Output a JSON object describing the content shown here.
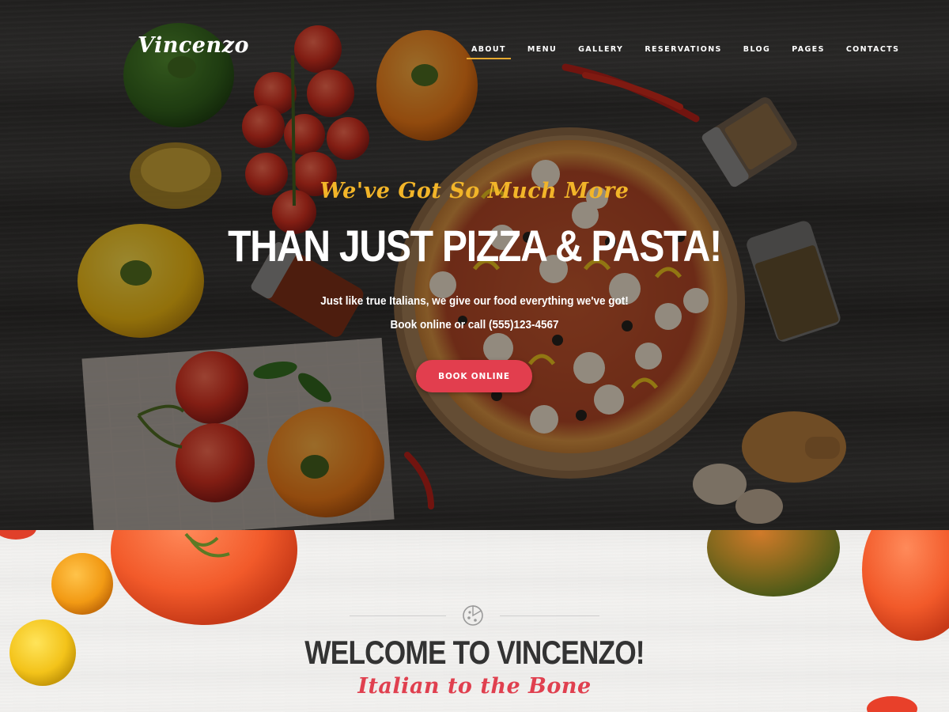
{
  "brand": {
    "logo_text": "Vincenzo"
  },
  "nav": {
    "items": [
      {
        "label": "ABOUT"
      },
      {
        "label": "MENU"
      },
      {
        "label": "GALLERY"
      },
      {
        "label": "RESERVATIONS"
      },
      {
        "label": "BLOG"
      },
      {
        "label": "PAGES"
      },
      {
        "label": "CONTACTS"
      }
    ],
    "active_item": "ABOUT"
  },
  "hero": {
    "script_heading": "We've Got So Much More",
    "title": "THAN JUST PIZZA & PASTA!",
    "subtitle_line1": "Just like true Italians, we give our food everything we've got!",
    "subtitle_line2": "Book online or call (555)123-4567",
    "cta_label": "BOOK ONLINE"
  },
  "welcome": {
    "title": "WELCOME TO VINCENZO!",
    "script_subtitle": "Italian to the Bone",
    "divider_icon": "pizza-slice-icon"
  },
  "colors": {
    "accent_yellow": "#f2b529",
    "accent_red": "#e23e4e",
    "nav_underline": "#e7a92f",
    "welcome_title": "#333333",
    "welcome_script": "#e0404f"
  }
}
